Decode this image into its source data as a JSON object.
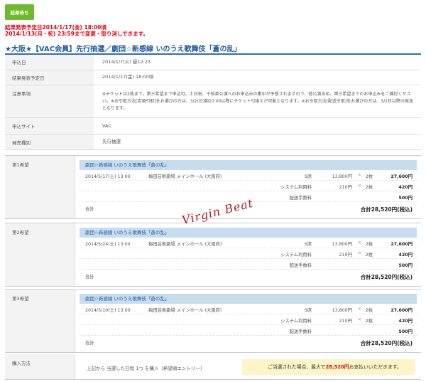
{
  "status_badge": "結果待ち",
  "notice": {
    "line1": "結果発表予定日2014/1/17(金) 18:00頃",
    "line2": "2014/1/13(月・祝) 23:59まで変更・取り消しできます。"
  },
  "event_title": "★大阪★【VAC会員】先行抽選／劇団☆新感線 いのうえ歌舞伎「蒼の乱」",
  "info": [
    {
      "label": "申込日",
      "value": "2014/1/7(火) 昼12:23"
    },
    {
      "label": "結果発表予定日",
      "value": "2014/1/17(金) 18:00頃"
    },
    {
      "label": "注意事項",
      "value": "※チケットは2枚まで。第三希望まで申込可。土日祝、千秋楽公演へのお申込みの集中が予想されますので、他公演含め、第三希望までのお申込みをご検討ください。※お引取方法[店頭引取]をお選びの方は、3/2(日)朝10:00以降にチケット引換えが可能となります。※お引取方法[配送引取]をお選びの方は、3/2日以降の発送となります。"
    },
    {
      "label": "申込サイト",
      "value": "VAC"
    },
    {
      "label": "発売種別",
      "value": "先行抽選"
    }
  ],
  "choices": [
    {
      "label": "第1希望",
      "perf": "劇団☆新感線 いのうえ歌舞伎「蒼の乱」",
      "date": "2014/5/17(土) 13:00",
      "venue": "梅田芸術劇場 メインホール (大阪府)",
      "rows": [
        {
          "item": "S席",
          "price": "13,800円",
          "x": "✕",
          "qty": "2枚",
          "sub": "27,600円"
        },
        {
          "item": "システム利用料",
          "price": "210円",
          "x": "✕",
          "qty": "2枚",
          "sub": "420円"
        },
        {
          "item": "配送手数料",
          "price": "",
          "x": "",
          "qty": "",
          "sub": "500円"
        }
      ],
      "total_label": "合計",
      "total": "合計28,520円(税込)"
    },
    {
      "label": "第2希望",
      "perf": "劇団☆新感線 いのうえ歌舞伎「蒼の乱」",
      "date": "2014/5/24(土) 13:00",
      "venue": "梅田芸術劇場 メインホール (大阪府)",
      "rows": [
        {
          "item": "S席",
          "price": "13,800円",
          "x": "✕",
          "qty": "2枚",
          "sub": "27,600円"
        },
        {
          "item": "システム利用料",
          "price": "210円",
          "x": "✕",
          "qty": "2枚",
          "sub": "420円"
        },
        {
          "item": "配送手数料",
          "price": "",
          "x": "",
          "qty": "",
          "sub": "500円"
        }
      ],
      "total_label": "合計",
      "total": "合計28,520円(税込)"
    },
    {
      "label": "第3希望",
      "perf": "劇団☆新感線 いのうえ歌舞伎「蒼の乱」",
      "date": "2014/5/10(土) 13:00",
      "venue": "梅田芸術劇場 メインホール (大阪府)",
      "rows": [
        {
          "item": "S席",
          "price": "13,800円",
          "x": "✕",
          "qty": "2枚",
          "sub": "27,600円"
        },
        {
          "item": "システム利用料",
          "price": "210円",
          "x": "✕",
          "qty": "2枚",
          "sub": "420円"
        },
        {
          "item": "配送手数料",
          "price": "",
          "x": "",
          "qty": "",
          "sub": "500円"
        }
      ],
      "total_label": "合計",
      "total": "合計28,520円(税込)"
    }
  ],
  "watermark": "Virgin Beat",
  "purchase": {
    "label": "購入方法",
    "text": "上記から 当選した日程 1つ を購入（希望順エントリー）",
    "note_pre": "ご当選された場合、最大で",
    "note_amount": "28,520円",
    "note_post": "お支払いいただきます。"
  }
}
